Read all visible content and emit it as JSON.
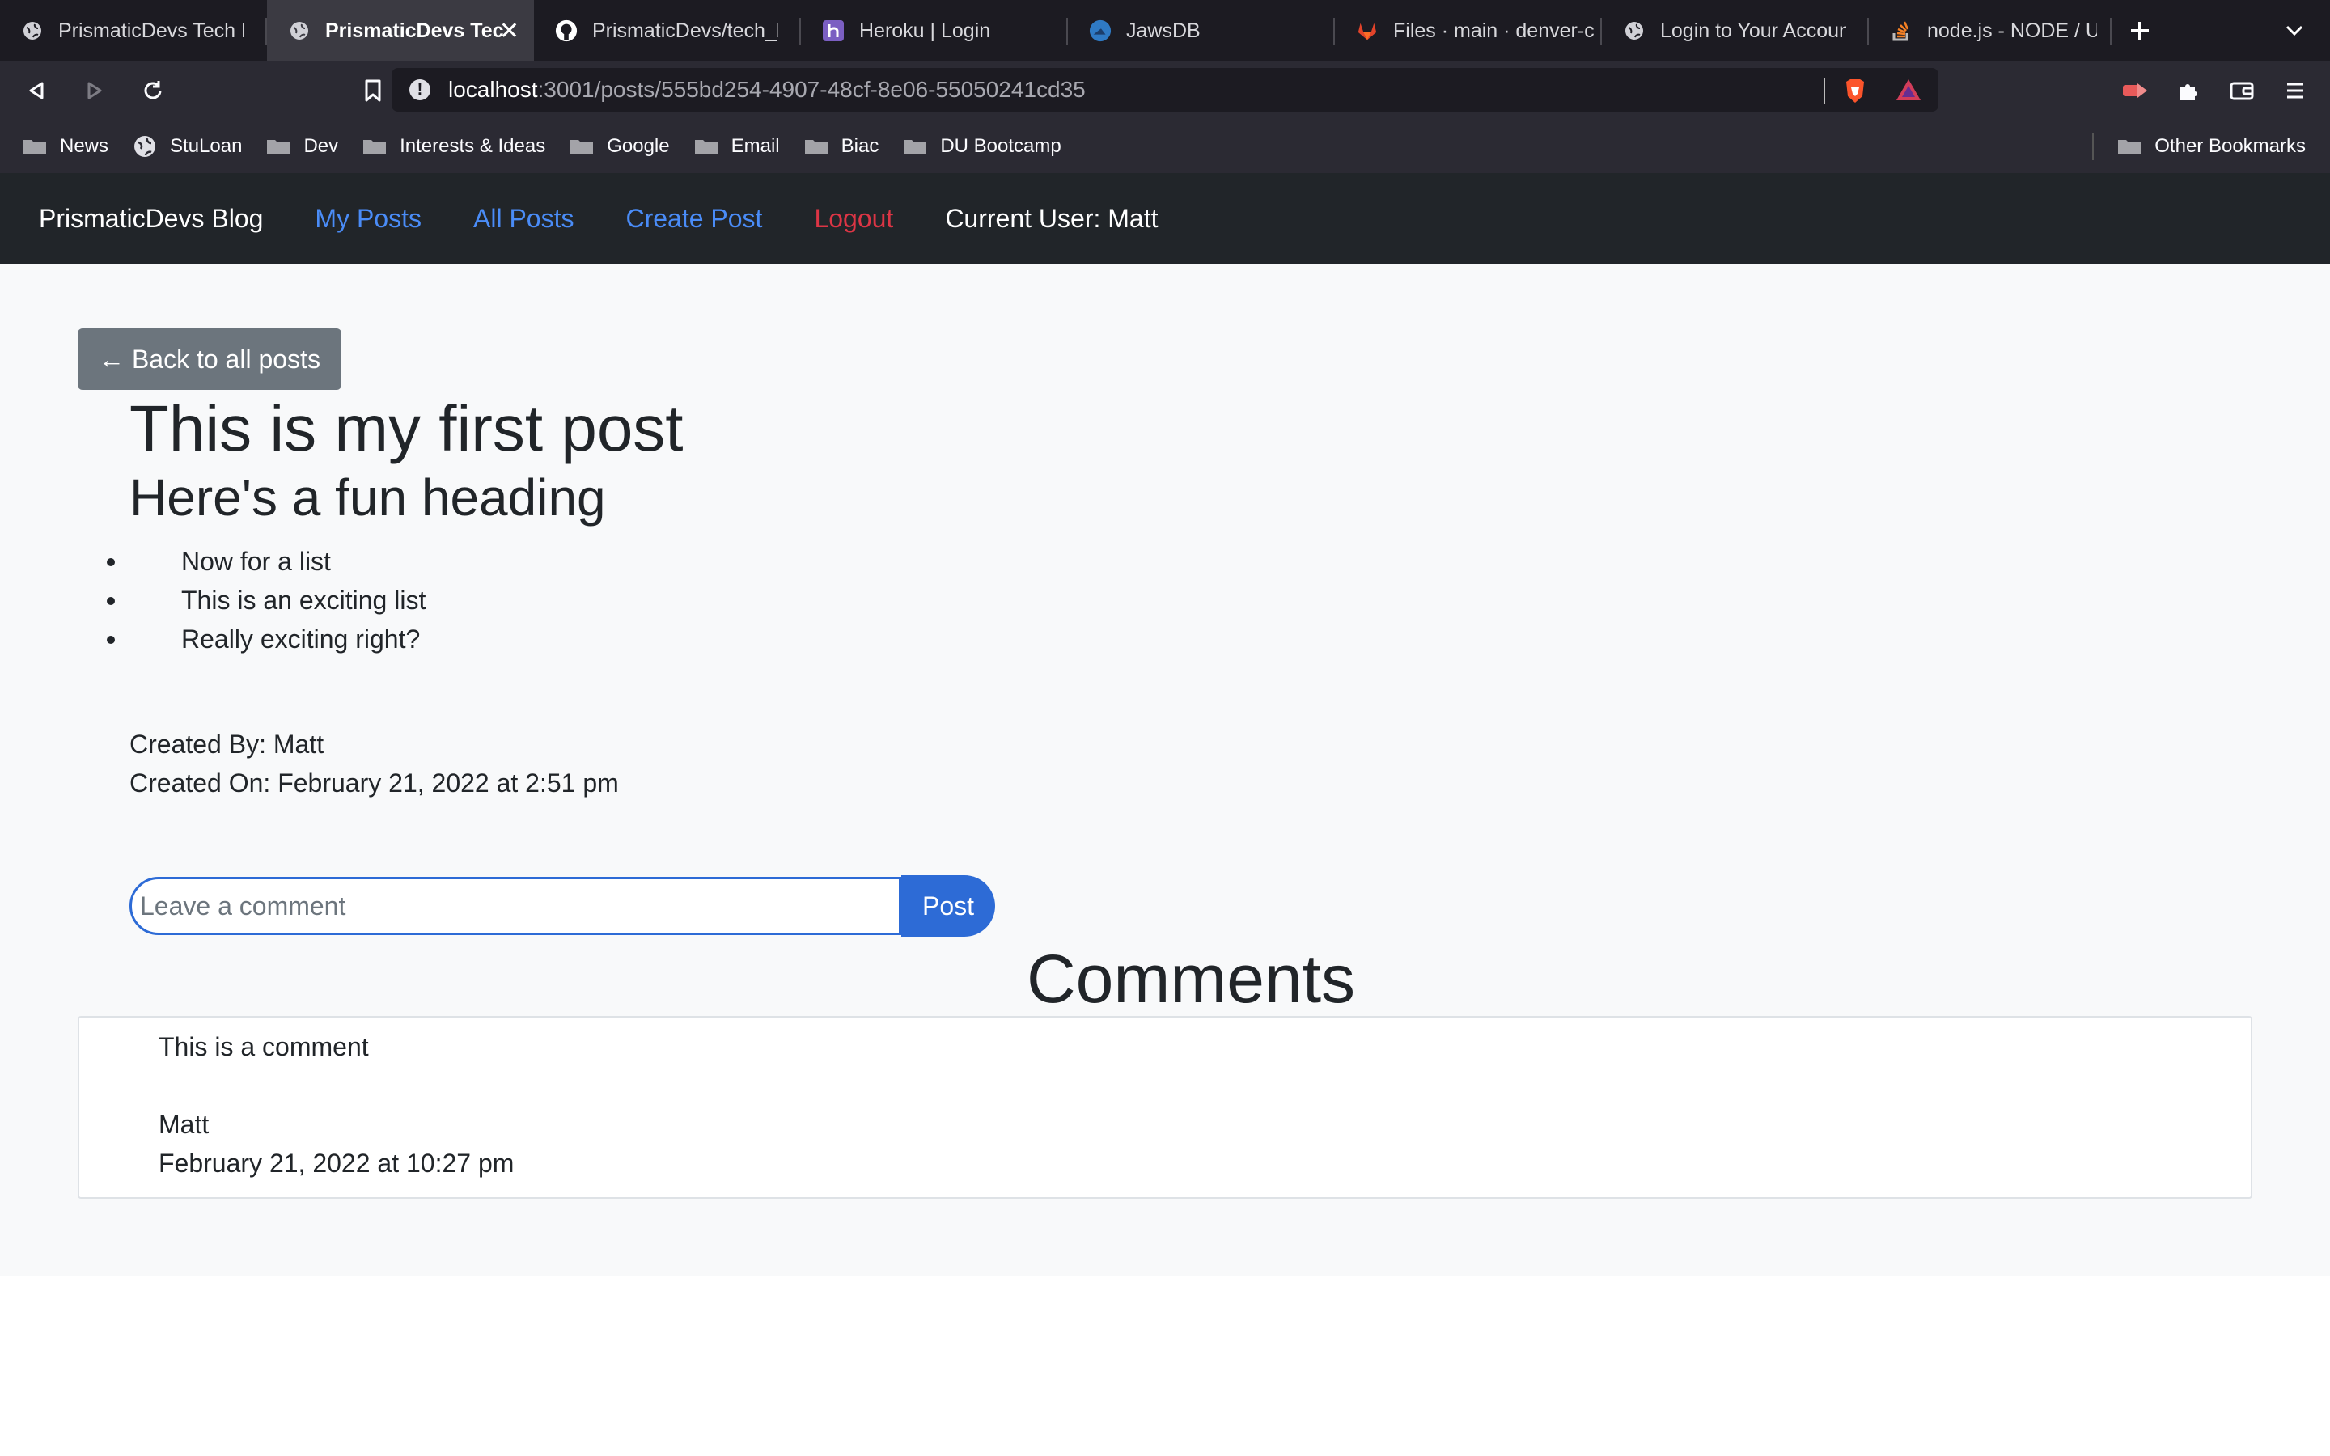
{
  "browser": {
    "tabs": [
      {
        "title": "PrismaticDevs Tech Blog",
        "icon": "globe-icon",
        "active": false
      },
      {
        "title": "PrismaticDevs Tech Blog",
        "icon": "globe-icon",
        "active": true,
        "close": "✕"
      },
      {
        "title": "PrismaticDevs/tech_blog",
        "icon": "github-icon",
        "active": false
      },
      {
        "title": "Heroku | Login",
        "icon": "heroku-icon",
        "active": false
      },
      {
        "title": "JawsDB",
        "icon": "jawsdb-icon",
        "active": false
      },
      {
        "title": "Files · main · denver-coding",
        "icon": "gitlab-icon",
        "active": false
      },
      {
        "title": "Login to Your Account",
        "icon": "globe-icon",
        "active": false
      },
      {
        "title": "node.js - NODE / UPDATE",
        "icon": "stackoverflow-icon",
        "active": false
      }
    ],
    "url": {
      "host": "localhost",
      "path": ":3001/posts/555bd254-4907-48cf-8e06-55050241cd35"
    },
    "bookmarks": [
      {
        "label": "News",
        "icon": "folder-icon"
      },
      {
        "label": "StuLoan",
        "icon": "globe-icon"
      },
      {
        "label": "Dev",
        "icon": "folder-icon"
      },
      {
        "label": "Interests & Ideas",
        "icon": "folder-icon"
      },
      {
        "label": "Google",
        "icon": "folder-icon"
      },
      {
        "label": "Email",
        "icon": "folder-icon"
      },
      {
        "label": "Biac",
        "icon": "folder-icon"
      },
      {
        "label": "DU Bootcamp",
        "icon": "folder-icon"
      }
    ],
    "other_bookmarks": "Other Bookmarks"
  },
  "nav": {
    "brand": "PrismaticDevs Blog",
    "my_posts": "My Posts",
    "all_posts": "All Posts",
    "create_post": "Create Post",
    "logout": "Logout",
    "current_user": "Current User: Matt"
  },
  "post": {
    "back_label": "← Back to all posts",
    "title": "This is my first post",
    "heading": "Here's a fun heading",
    "list": [
      "Now for a list",
      "This is an exciting list",
      "Really exciting right?"
    ],
    "created_by": "Created By: Matt",
    "created_on": "Created On: February 21, 2022 at 2:51 pm"
  },
  "comment_form": {
    "placeholder": "Leave a comment",
    "value": "",
    "submit_label": "Post"
  },
  "comments": {
    "heading": "Comments",
    "items": [
      {
        "text": "This is a comment",
        "author": "Matt",
        "date": "February 21, 2022 at 10:27 pm"
      }
    ]
  },
  "colors": {
    "navbar_bg": "#212529",
    "link": "#4a8cf7",
    "logout": "#dc3545",
    "primary_button": "#2d6bd6",
    "secondary_button": "#6c757d",
    "content_bg": "#f8f9fa"
  }
}
